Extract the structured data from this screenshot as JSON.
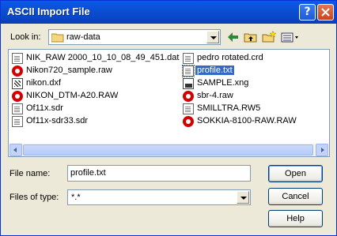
{
  "window": {
    "title": "ASCII Import File"
  },
  "lookin": {
    "label": "Look in:",
    "value": "raw-data"
  },
  "toolbar": {
    "back_icon": "back-arrow-icon",
    "up_icon": "up-folder-icon",
    "new_icon": "new-folder-icon",
    "view_icon": "view-menu-icon"
  },
  "files": [
    {
      "name": "NIK_RAW 2000_10_10_08_49_451.dat",
      "icon": "document-icon"
    },
    {
      "name": "Nikon720_sample.raw",
      "icon": "raw-file-icon"
    },
    {
      "name": "nikon.dxf",
      "icon": "dxf-file-icon"
    },
    {
      "name": "NIKON_DTM-A20.RAW",
      "icon": "raw-file-icon"
    },
    {
      "name": "Of11x.sdr",
      "icon": "document-icon"
    },
    {
      "name": "Of11x-sdr33.sdr",
      "icon": "document-icon"
    },
    {
      "name": "pedro rotated.crd",
      "icon": "document-icon"
    },
    {
      "name": "profile.txt",
      "icon": "document-icon",
      "selected": true
    },
    {
      "name": "SAMPLE.xng",
      "icon": "xng-file-icon"
    },
    {
      "name": "sbr-4.raw",
      "icon": "raw-file-icon"
    },
    {
      "name": "SMILLTRA.RW5",
      "icon": "document-icon"
    },
    {
      "name": "SOKKIA-8100-RAW.RAW",
      "icon": "raw-file-icon"
    }
  ],
  "filename": {
    "label": "File name:",
    "value": "profile.txt"
  },
  "filetype": {
    "label": "Files of type:",
    "value": "*.*"
  },
  "buttons": {
    "open": "Open",
    "cancel": "Cancel",
    "help": "Help"
  },
  "colors": {
    "titlebar": "#0b4fd4",
    "selection": "#316ac5",
    "raw_icon": "#d40000",
    "folder": "#f5d67a"
  }
}
